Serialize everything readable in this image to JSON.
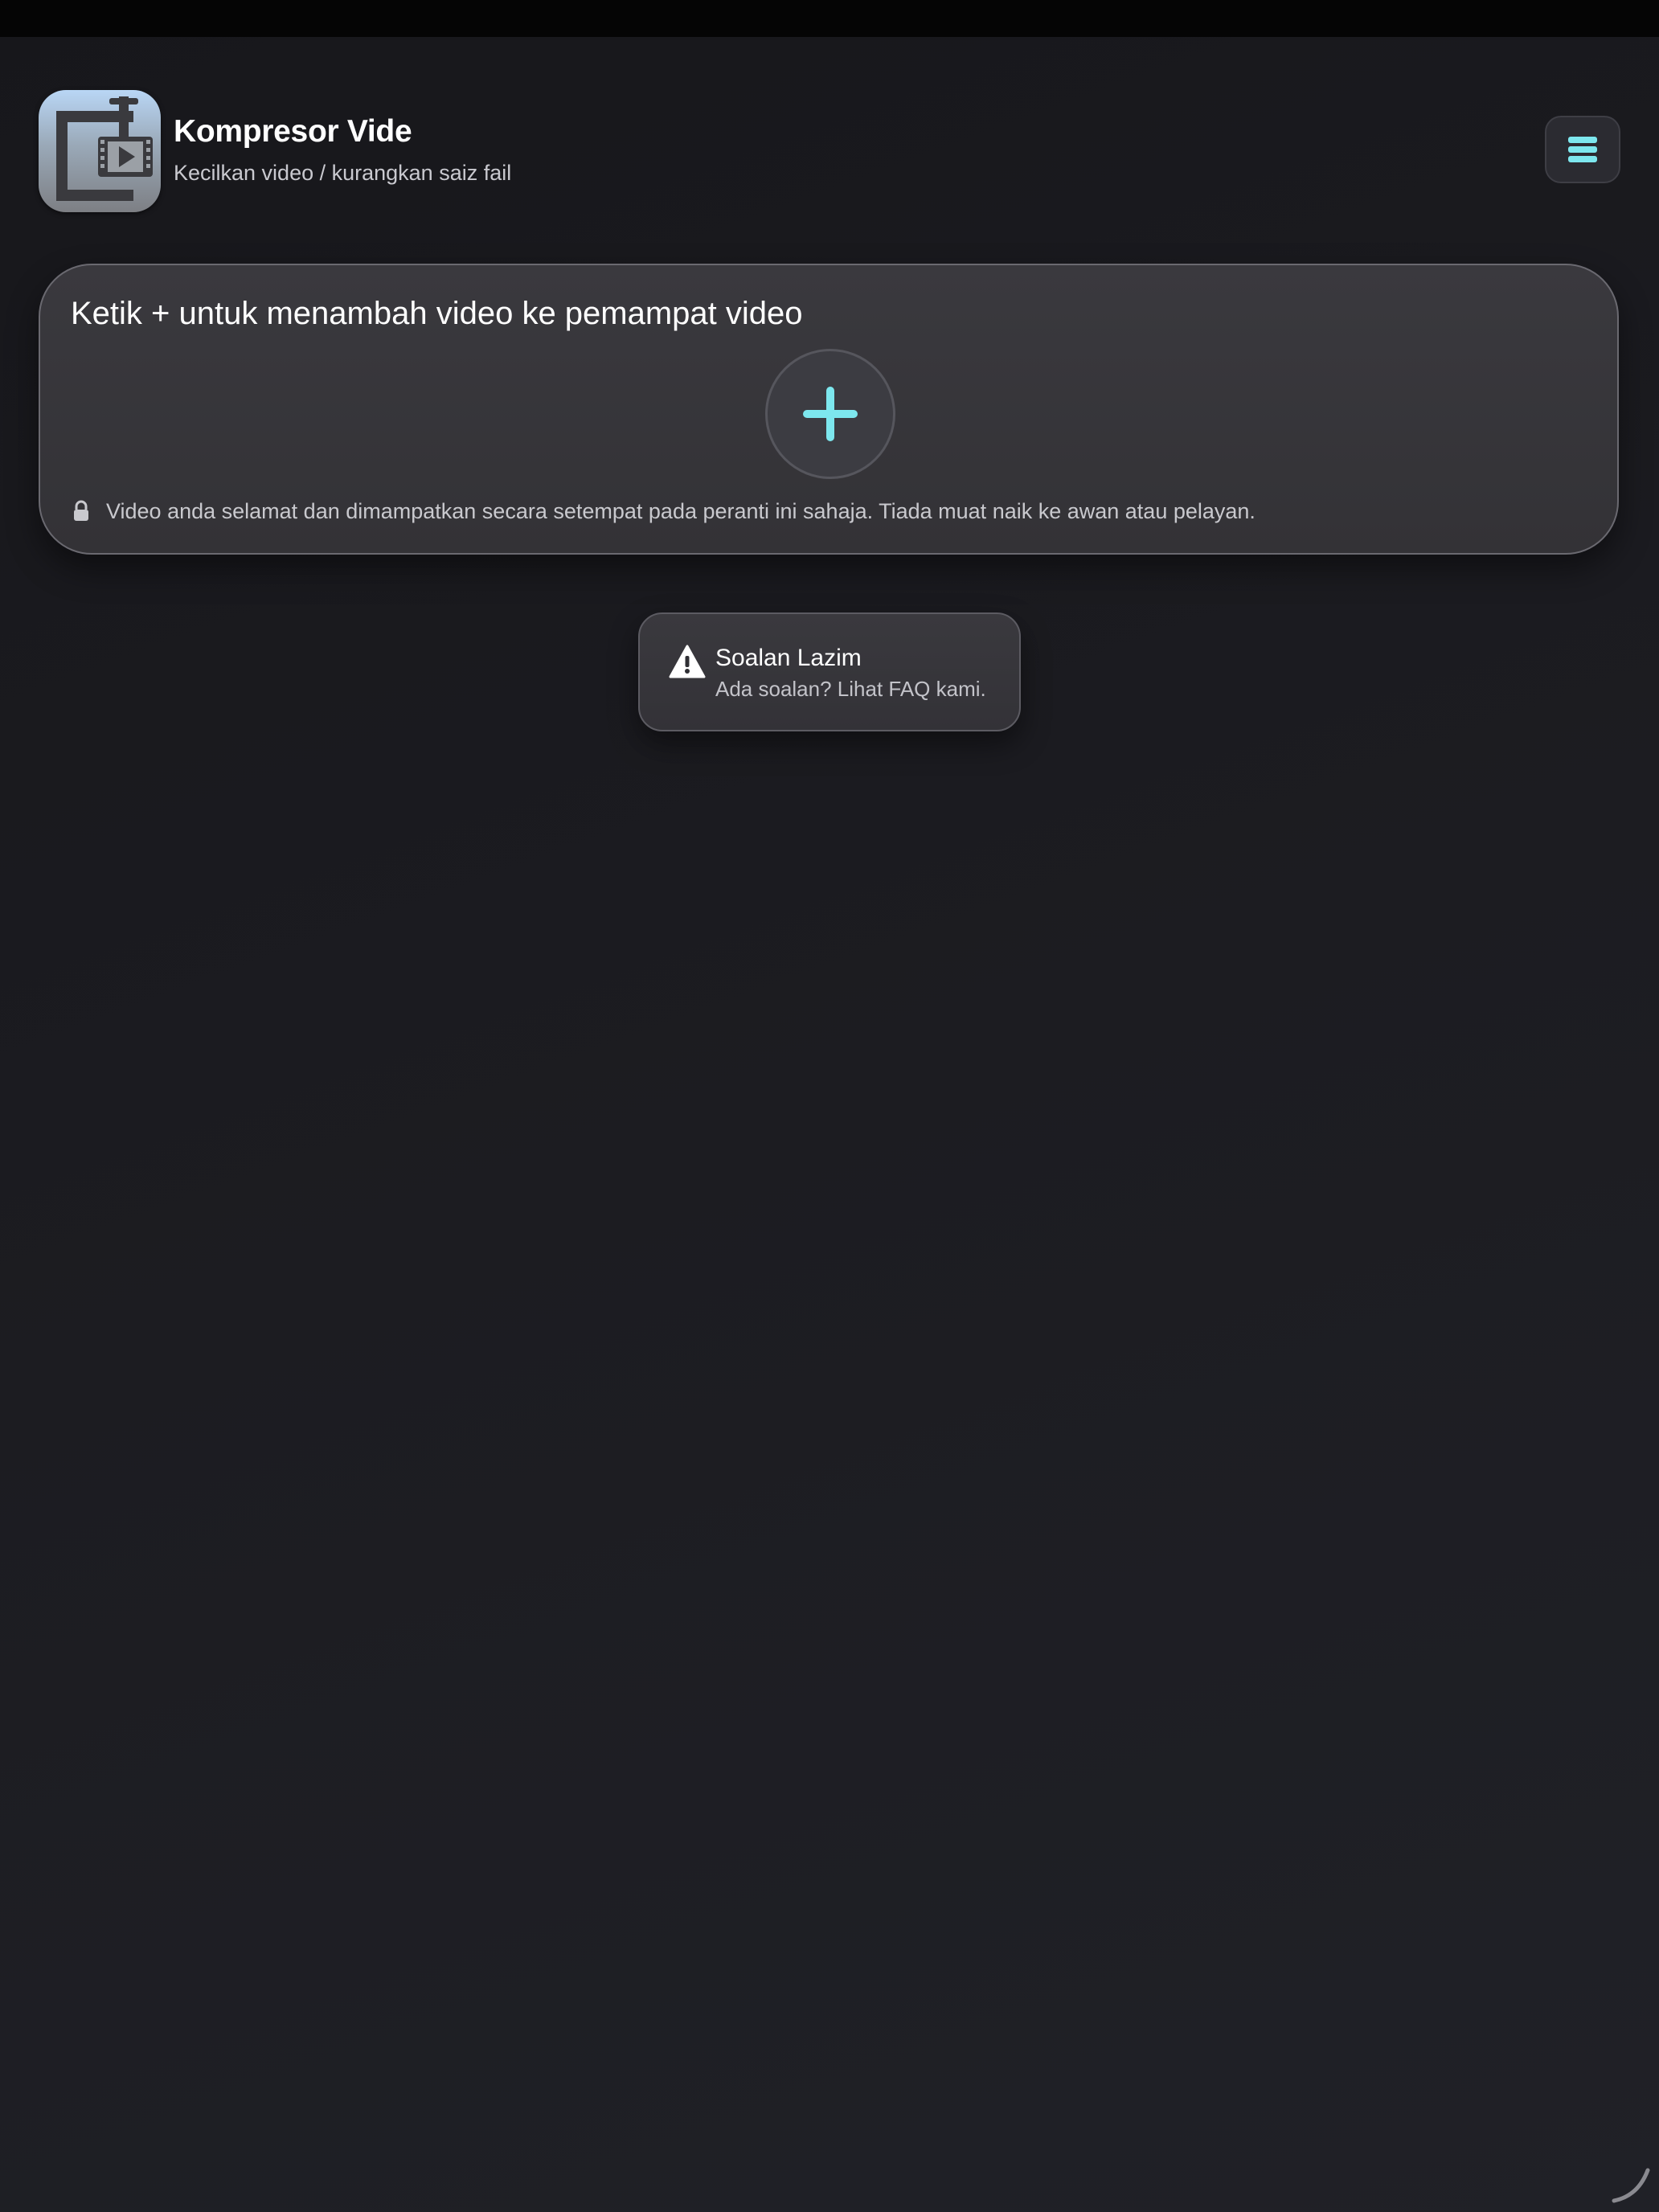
{
  "header": {
    "app_title": "Kompresor Vide",
    "app_subtitle": "Kecilkan video / kurangkan saiz fail",
    "app_icon": "video-clamp-icon",
    "menu_icon": "stack-menu-icon"
  },
  "add_card": {
    "title": "Ketik + untuk menambah video ke pemampat video",
    "add_icon": "plus-icon",
    "privacy_icon": "lock-icon",
    "privacy_text": "Video anda selamat dan dimampatkan secara setempat pada peranti ini sahaja. Tiada muat naik ke awan atau pelayan."
  },
  "faq": {
    "icon": "warning-icon",
    "title": "Soalan Lazim",
    "subtitle": "Ada soalan? Lihat FAQ kami."
  },
  "colors": {
    "accent": "#7de7ee",
    "background": "#1c1c21",
    "card": "#36353a"
  }
}
